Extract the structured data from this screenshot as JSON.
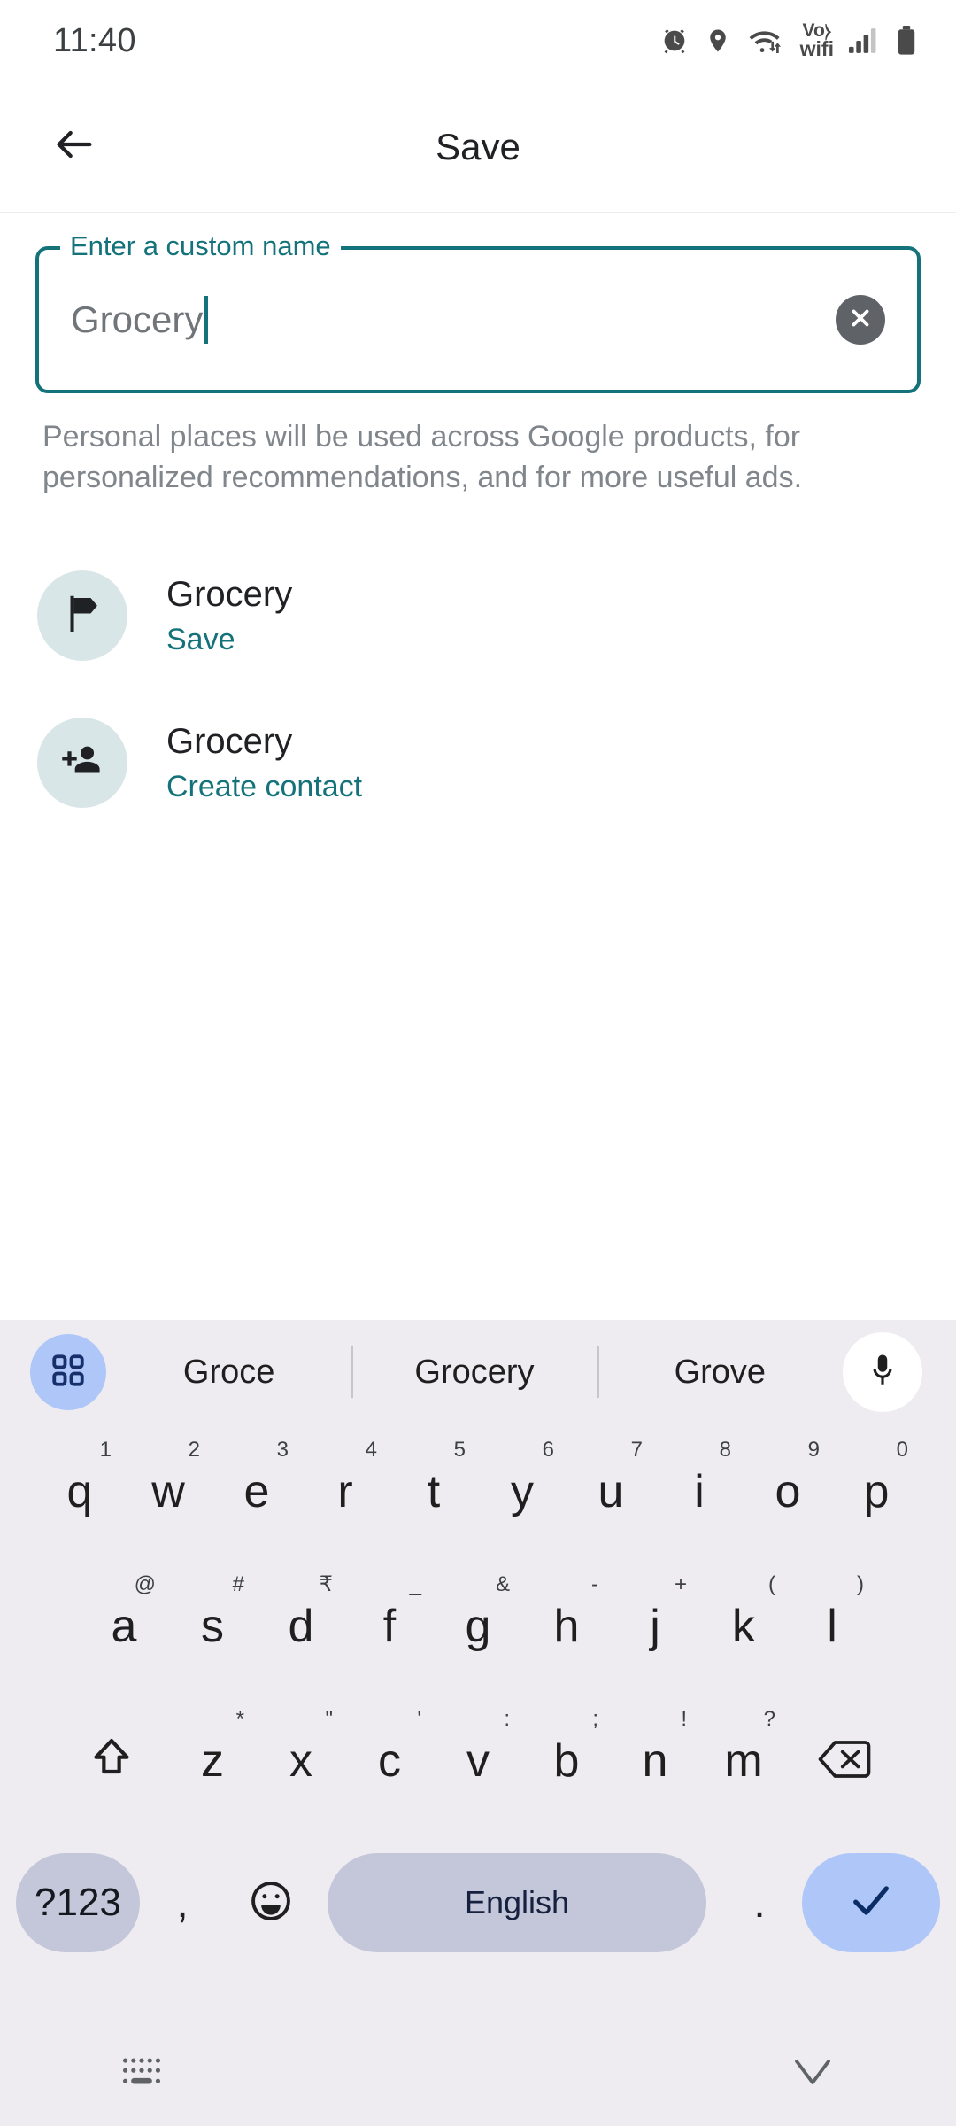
{
  "statusbar": {
    "time": "11:40",
    "icons": [
      "alarm-icon",
      "location-icon",
      "wifi-icon",
      "vowifi-icon",
      "signal-icon",
      "battery-icon"
    ],
    "vowifi_line1": "Vo⧽",
    "vowifi_line2": "wifi"
  },
  "appbar": {
    "back_icon": "back-arrow-icon",
    "title": "Save"
  },
  "field": {
    "label": "Enter a custom name",
    "value": "Grocery",
    "clear_icon": "close-circle-icon"
  },
  "helper": {
    "text": "Personal places will be used across Google products, for personalized recommendations, and for more useful ads."
  },
  "list": {
    "items": [
      {
        "icon": "flag-icon",
        "title": "Grocery",
        "subtitle": "Save"
      },
      {
        "icon": "person-add-icon",
        "title": "Grocery",
        "subtitle": "Create contact"
      }
    ]
  },
  "keyboard": {
    "apps_icon": "apps-grid-icon",
    "mic_icon": "microphone-icon",
    "suggestions": [
      "Groce",
      "Grocery",
      "Grove"
    ],
    "row1": [
      {
        "main": "q",
        "alt": "1"
      },
      {
        "main": "w",
        "alt": "2"
      },
      {
        "main": "e",
        "alt": "3"
      },
      {
        "main": "r",
        "alt": "4"
      },
      {
        "main": "t",
        "alt": "5"
      },
      {
        "main": "y",
        "alt": "6"
      },
      {
        "main": "u",
        "alt": "7"
      },
      {
        "main": "i",
        "alt": "8"
      },
      {
        "main": "o",
        "alt": "9"
      },
      {
        "main": "p",
        "alt": "0"
      }
    ],
    "row2": [
      {
        "main": "a",
        "alt": "@"
      },
      {
        "main": "s",
        "alt": "#"
      },
      {
        "main": "d",
        "alt": "₹"
      },
      {
        "main": "f",
        "alt": "_"
      },
      {
        "main": "g",
        "alt": "&"
      },
      {
        "main": "h",
        "alt": "-"
      },
      {
        "main": "j",
        "alt": "+"
      },
      {
        "main": "k",
        "alt": "("
      },
      {
        "main": "l",
        "alt": ")"
      }
    ],
    "row3": [
      {
        "main": "z",
        "alt": "*"
      },
      {
        "main": "x",
        "alt": "\""
      },
      {
        "main": "c",
        "alt": "'"
      },
      {
        "main": "v",
        "alt": ":"
      },
      {
        "main": "b",
        "alt": ";"
      },
      {
        "main": "n",
        "alt": "!"
      },
      {
        "main": "m",
        "alt": "?"
      }
    ],
    "shift_icon": "shift-icon",
    "backspace_icon": "backspace-icon",
    "symbols_label": "?123",
    "comma_label": ",",
    "emoji_icon": "emoji-icon",
    "space_label": "English",
    "period_label": ".",
    "enter_icon": "checkmark-icon"
  },
  "navbar": {
    "keyboard_icon": "keyboard-switch-icon",
    "hide_icon": "chevron-down-icon"
  },
  "colors": {
    "teal": "#14737a",
    "icon_circle": "#d9e6e8",
    "keyboard_bg": "#eeecf0",
    "key_accent": "#aec6f8",
    "space_key": "#c3c7d9"
  }
}
